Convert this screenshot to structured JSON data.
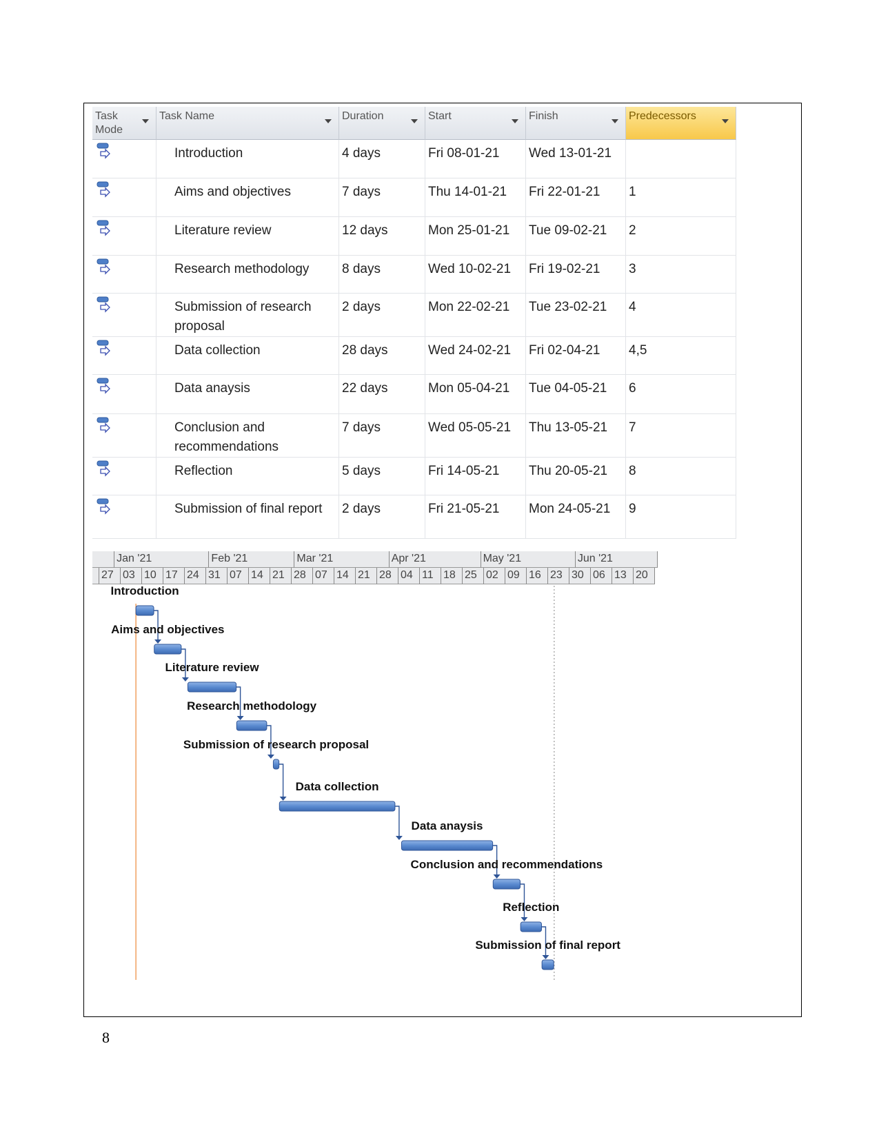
{
  "table": {
    "columns": [
      "Task Mode",
      "Task Name",
      "Duration",
      "Start",
      "Finish",
      "Predecessors"
    ],
    "rows": [
      {
        "name": "Introduction",
        "duration": "4 days",
        "start": "Fri 08-01-21",
        "finish": "Wed 13-01-21",
        "predecessors": ""
      },
      {
        "name": "Aims and objectives",
        "duration": "7 days",
        "start": "Thu 14-01-21",
        "finish": "Fri 22-01-21",
        "predecessors": "1"
      },
      {
        "name": "Literature review",
        "duration": "12 days",
        "start": "Mon 25-01-21",
        "finish": "Tue 09-02-21",
        "predecessors": "2"
      },
      {
        "name": "Research methodology",
        "duration": "8 days",
        "start": "Wed 10-02-21",
        "finish": "Fri 19-02-21",
        "predecessors": "3"
      },
      {
        "name": "Submission of research proposal",
        "duration": "2 days",
        "start": "Mon 22-02-21",
        "finish": "Tue 23-02-21",
        "predecessors": "4"
      },
      {
        "name": "Data collection",
        "duration": "28 days",
        "start": "Wed 24-02-21",
        "finish": "Fri 02-04-21",
        "predecessors": "4,5"
      },
      {
        "name": "Data anaysis",
        "duration": "22 days",
        "start": "Mon 05-04-21",
        "finish": "Tue 04-05-21",
        "predecessors": "6"
      },
      {
        "name": "Conclusion and recommendations",
        "duration": "7 days",
        "start": "Wed 05-05-21",
        "finish": "Thu 13-05-21",
        "predecessors": "7"
      },
      {
        "name": "Reflection",
        "duration": "5 days",
        "start": "Fri 14-05-21",
        "finish": "Thu 20-05-21",
        "predecessors": "8"
      },
      {
        "name": "Submission of final report",
        "duration": "2 days",
        "start": "Fri 21-05-21",
        "finish": "Mon 24-05-21",
        "predecessors": "9"
      }
    ],
    "task_mode_icon": "auto-scheduled-task-icon",
    "highlight_color": "#f8c84a"
  },
  "gantt": {
    "months": [
      "Jan '21",
      "Feb '21",
      "Mar '21",
      "Apr '21",
      "May '21",
      "Jun '21"
    ],
    "weeks": [
      "27",
      "03",
      "10",
      "17",
      "24",
      "31",
      "07",
      "14",
      "21",
      "28",
      "07",
      "14",
      "21",
      "28",
      "04",
      "11",
      "18",
      "25",
      "02",
      "09",
      "16",
      "23",
      "30",
      "06",
      "13",
      "20"
    ],
    "bar_color": "#5b8bd0",
    "project_start_line_color": "#f0a060"
  },
  "page_number": "8"
}
